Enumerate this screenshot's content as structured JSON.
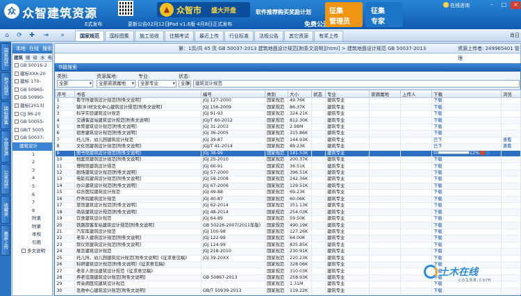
{
  "app": {
    "logo_symbol": "众",
    "title": "众智建筑资源",
    "estart": "E式发布",
    "update": "更新公告02月12日",
    "mall_name": "众智市",
    "mall_tag": "盛大开盘",
    "ipad": "iPad v1.6版  4月8日正式发布",
    "recommend": "软件推荐购买奖励计划",
    "weekly": "",
    "free": "免费公测",
    "collector": [
      "征集",
      "管理员"
    ],
    "expert": [
      "征集",
      "专家"
    ],
    "online": "在线咨询",
    "window_buttons": [
      "–",
      "□",
      "×"
    ],
    "right_user": "肖日"
  },
  "nav": {
    "icons": [
      "home-icon",
      "refresh-icon",
      "add-icon",
      "export-icon",
      "expand-icon"
    ],
    "tabs": [
      "国家规范",
      "国标图集",
      "施工验收",
      "往期考试",
      "最近上传",
      "行业标准",
      "法规公告",
      "其它资源",
      "有奖上传"
    ]
  },
  "side_tabs": [
    "国家规范",
    "地方规范",
    "国标图集",
    "全部资源",
    "公家规范",
    "收藏夹",
    "最新上传"
  ],
  "tree": {
    "top": [
      "本地",
      "在线",
      "搜索"
    ],
    "categories": [
      "建筑",
      "暖",
      "给",
      "水",
      "电",
      "消防"
    ],
    "items": [
      "GB 50016-2",
      "建标XXX-20",
      "建标 170-",
      "GB 50965-",
      "GB 50990-",
      "建标[2013]",
      "CJJ 96-20",
      "GB 50055-",
      "GB/T 5005",
      "GB 50037-",
      "建筑设计",
      "1",
      "2",
      "3",
      "4",
      "5",
      "6",
      "7",
      "8",
      "附录",
      "附录",
      "本规",
      "引用",
      "多文说明"
    ]
  },
  "path": {
    "left": "第：1页/共 45 页    GB 50037-2013 建筑地面设计规范[附条文说明][html] > 建筑地面设计规范 GB 50037-2013",
    "right": "资源上传者: 249965401    管理"
  },
  "dialog": {
    "title": "书籍搜索",
    "filters": {
      "category_label": "类别:",
      "category_value": "全部",
      "place_label": "资源属地:",
      "place_value": "全部资源属地",
      "major_label": "专业:",
      "major_value": "全部专业",
      "status_label": "状态:",
      "status_value": "全部",
      "keyword": "建筑设计规范"
    },
    "columns": [
      "序号",
      "书名",
      "编号",
      "类别",
      "大小",
      "状态",
      "专业",
      "资源属地",
      "上传人",
      "下载",
      "浏览"
    ],
    "rows": [
      [
        "1",
        "看守所建筑设计规范[附条文说明]",
        "JGJ 127-2000",
        "国家规范",
        "49.76K",
        "",
        "建筑专业",
        "",
        "",
        "下载",
        ""
      ],
      [
        "2",
        "镇(乡)村文化中心建筑设计规范[附条文说明]",
        "JGJ 156-2009",
        "国家规范",
        "86.37K",
        "",
        "建筑专业",
        "",
        "",
        "下载",
        ""
      ],
      [
        "3",
        "科学实验建筑设计规范",
        "JGJ 91-93",
        "国家规范",
        "324.21K",
        "",
        "建筑专业",
        "",
        "",
        "下载",
        ""
      ],
      [
        "4",
        "交通客运站建筑设计规范[附条文说明]",
        "JGJ/T 60-2012",
        "国家规范",
        "812.30K",
        "",
        "建筑专业",
        "",
        "",
        "下载",
        ""
      ],
      [
        "5",
        "体育建筑设计规范[附条文说明]",
        "JGJ 31-2003",
        "国家规范",
        "2.98M",
        "",
        "建筑专业",
        "",
        "",
        "下载",
        ""
      ],
      [
        "6",
        "宿舍建筑设计规范[附条文说明]",
        "JGJ 36-2005",
        "国家规范",
        "315.86K",
        "",
        "建筑专业",
        "",
        "",
        "下载",
        ""
      ],
      [
        "7",
        "托儿所、幼儿园建筑设计规范",
        "JGJ 39-87",
        "国家规范",
        "144.93K",
        "",
        "建筑专业",
        "",
        "",
        "已下",
        "查看"
      ],
      [
        "8",
        "文化馆建筑设计规范[附条文说明]",
        "JGJ/T 41-2014",
        "国家规范",
        "89.23K",
        "",
        "建筑专业",
        "",
        "",
        "已下",
        "查看"
      ],
      [
        "9",
        "图书馆建筑设计规范[附条文说明]",
        "JGJ 38-99",
        "国家规范",
        "181.53K",
        "",
        "建筑专业",
        "",
        "",
        "12%",
        ""
      ],
      [
        "10",
        "档案馆建筑设计规范[附条文说明]",
        "JGJ 25-2010",
        "国家规范",
        "200.37K",
        "",
        "建筑专业",
        "",
        "",
        "下载",
        ""
      ],
      [
        "11",
        "博物馆建筑设计规范",
        "JGJ 66-91",
        "国家规范",
        "36.51K",
        "",
        "建筑专业",
        "",
        "",
        "下载",
        ""
      ],
      [
        "12",
        "剧场建筑设计规范[附条文说明]",
        "JGJ 57-2000",
        "国家规范",
        "396.51K",
        "",
        "建筑专业",
        "",
        "",
        "下载",
        ""
      ],
      [
        "13",
        "电影院建筑设计规范[附条文说明]",
        "JGJ 58-2008",
        "国家规范",
        "242.36K",
        "",
        "建筑专业",
        "",
        "",
        "下载",
        ""
      ],
      [
        "14",
        "办公建筑设计规范[附条文说明]",
        "JGJ 67-2006",
        "国家规范",
        "129.51K",
        "",
        "建筑专业",
        "",
        "",
        "下载",
        ""
      ],
      [
        "15",
        "综合医院建筑设计规范",
        "JGJ 49-88",
        "国家规范",
        "69.23K",
        "",
        "建筑专业",
        "",
        "",
        "下载",
        ""
      ],
      [
        "16",
        "疗养院建筑设计规范",
        "JGJ 40-87",
        "国家规范",
        "60.06K",
        "",
        "建筑专业",
        "",
        "",
        "下载",
        ""
      ],
      [
        "17",
        "旅馆建筑设计规范[附条文说明]",
        "JGJ 62-2014",
        "国家规范",
        "351.13K",
        "",
        "建筑专业",
        "",
        "",
        "下载",
        ""
      ],
      [
        "18",
        "商店建筑设计规范[附条文说明]",
        "JGJ 48-2014",
        "国家规范",
        "254.03K",
        "",
        "建筑专业",
        "",
        "",
        "下载",
        ""
      ],
      [
        "19",
        "饮食建筑设计规范",
        "JGJ 64-89",
        "国家规范",
        "59.50K",
        "",
        "建筑专业",
        "",
        "",
        "下载",
        ""
      ],
      [
        "20",
        "铁路旅客车站建筑设计规范[附条文说明]",
        "GB 50226-2007(2011年版)",
        "国家规范",
        "490.19K",
        "",
        "建筑专业",
        "",
        "",
        "下载",
        ""
      ],
      [
        "21",
        "汽车库建筑设计规范",
        "JGJ 100-98",
        "国家规范",
        "127.26K",
        "",
        "建筑专业",
        "",
        "",
        "下载",
        ""
      ],
      [
        "22",
        "老年人建筑设计规范[附条文说明]",
        "JGJ 122-99",
        "国家规范",
        "64.00K",
        "",
        "建筑专业",
        "",
        "",
        "下载",
        ""
      ],
      [
        "23",
        "殡仪馆建筑设计规范[附条文说明]",
        "JGJ 124-99",
        "国家规范",
        "835.85K",
        "",
        "建筑专业",
        "",
        "",
        "下载",
        ""
      ],
      [
        "24",
        "展览建筑设计规范",
        "JGJ 218-2010",
        "国家规范",
        "230.91K",
        "",
        "建筑专业",
        "",
        "",
        "下载",
        ""
      ],
      [
        "25",
        "托儿所、幼儿园建筑设计规范[附条文说明]《征求意见稿》",
        "JGJ 39-20XX",
        "国家规范",
        "220.23K",
        "",
        "建筑专业",
        "",
        "",
        "下载",
        ""
      ],
      [
        "26",
        "科研建筑设计规范[附条文说明]《征求意见稿》",
        "",
        "国家规范",
        "328.06K",
        "",
        "建筑专业",
        "",
        "",
        "下载",
        ""
      ],
      [
        "27",
        "老年人居住建筑设计规范《征求意见稿》",
        "",
        "国家规范",
        "310.03K",
        "",
        "建筑专业",
        "",
        "",
        "下载",
        ""
      ],
      [
        "28",
        "养老设施建筑设计规范[附条文说明]",
        "GB 50867-2013",
        "国家规范",
        "258.93K",
        "",
        "建筑专业",
        "",
        "",
        "下载",
        ""
      ],
      [
        "29",
        "传染病医院建筑设计规范",
        "",
        "国家规范",
        "1.31M",
        "",
        "建筑专业",
        "",
        "",
        "下载",
        ""
      ],
      [
        "30",
        "急救中心建筑设计规范[附条文说明]",
        "GB/T 50939-2013",
        "国家规范",
        "119.22K",
        "",
        "建筑专业",
        "",
        "",
        "下载",
        ""
      ]
    ],
    "progress_row_index": 8,
    "progress_percent": 12
  },
  "watermark": {
    "text": "土木在线",
    "sub": "co188.com"
  },
  "colors": {
    "banner": "#1464b8",
    "accent": "#f09512",
    "selected_row": "#2d6fc4"
  }
}
